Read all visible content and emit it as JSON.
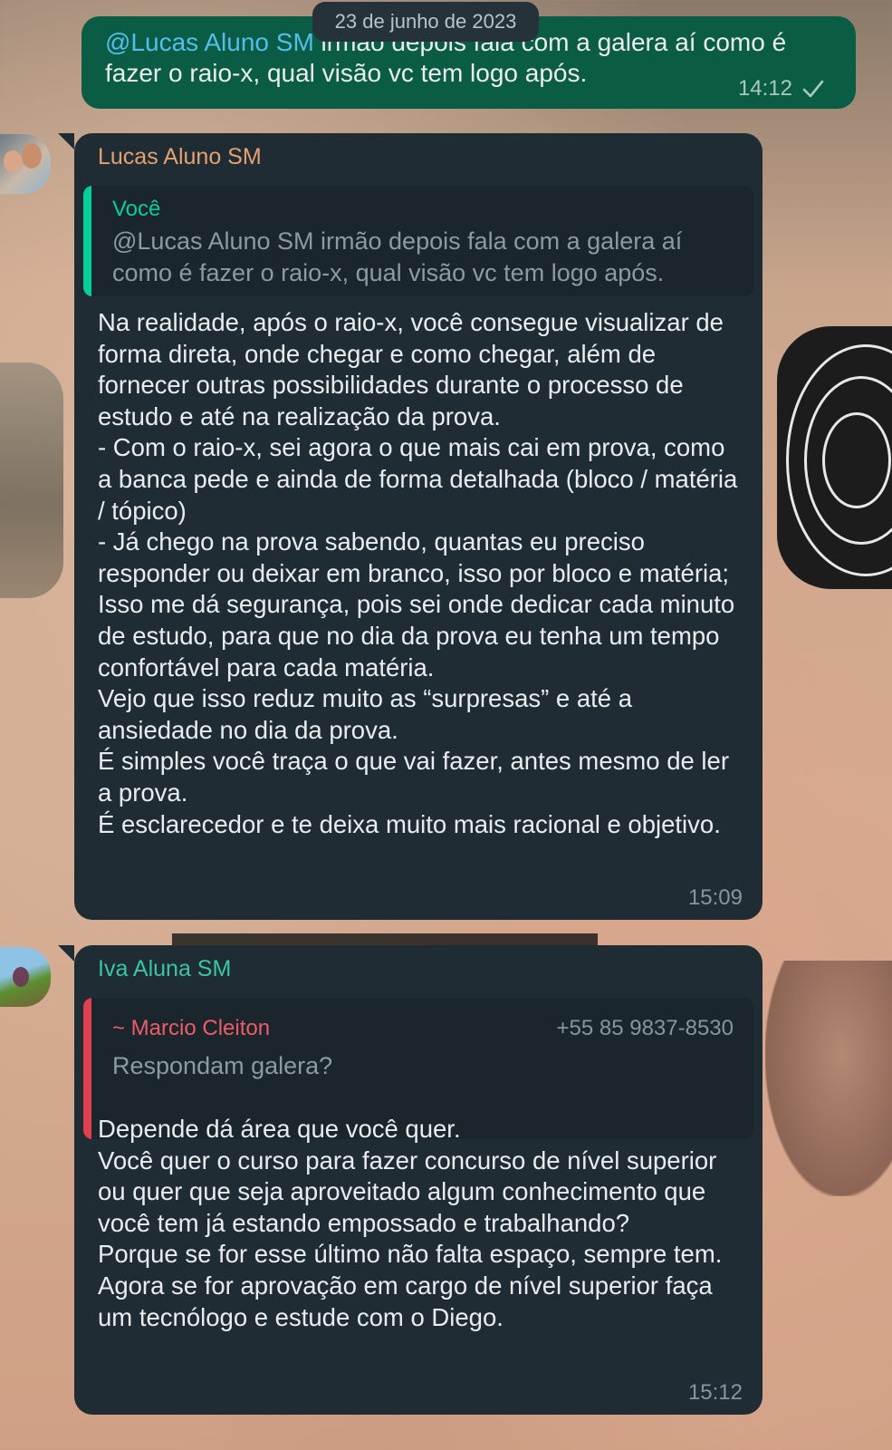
{
  "date_separator": "23 de junho de 2023",
  "outgoing": {
    "mention": "@Lucas Aluno SM",
    "text": " irmão depois fala com a galera aí como é fazer o raio-x, qual visão vc tem logo após.",
    "time": "14:12"
  },
  "messages": [
    {
      "sender": "Lucas Aluno SM",
      "reply": {
        "author": "Você",
        "text": "@Lucas Aluno SM  irmão depois fala com a galera aí como é fazer o raio-x, qual visão vc tem logo após."
      },
      "text": "Na realidade, após o raio-x, você consegue visualizar de forma direta, onde chegar e como chegar, além de fornecer outras possibilidades durante o processo de estudo e até na realização da prova.\n- Com o raio-x, sei agora o que mais cai em prova, como a banca pede e ainda de forma detalhada (bloco / matéria / tópico)\n- Já chego na prova sabendo, quantas eu preciso responder ou deixar em branco, isso por bloco e matéria;\nIsso me dá segurança, pois sei onde dedicar cada minuto de estudo, para que no dia da prova eu tenha um tempo confortável para cada matéria.\nVejo que isso reduz muito as “surpresas” e até a ansiedade no dia da prova.\nÉ simples você traça o que vai fazer, antes mesmo de ler a prova.\nÉ esclarecedor e te deixa muito mais racional e objetivo.",
      "time": "15:09"
    },
    {
      "sender": "Iva Aluna SM",
      "reply": {
        "author": "~ Marcio Cleiton",
        "phone": "+55 85 9837-8530",
        "text": "Respondam galera?"
      },
      "text": "Depende dá área que você quer.\nVocê quer o curso para fazer concurso de nível superior ou quer que seja aproveitado algum conhecimento que você tem já estando empossado e trabalhando?\nPorque se for esse último não falta espaço, sempre tem. Agora se for aprovação em cargo de nível superior faça um tecnólogo e estude com o Diego.",
      "time": "15:12"
    }
  ],
  "colors": {
    "outgoing_bubble": "#0b5c45",
    "incoming_bubble": "#1f2c34",
    "lucas_name": "#e7a16e",
    "iva_name": "#39c6a4",
    "quote_self_bar": "#06cf9c",
    "quote_marcio_bar": "#e0404e"
  }
}
